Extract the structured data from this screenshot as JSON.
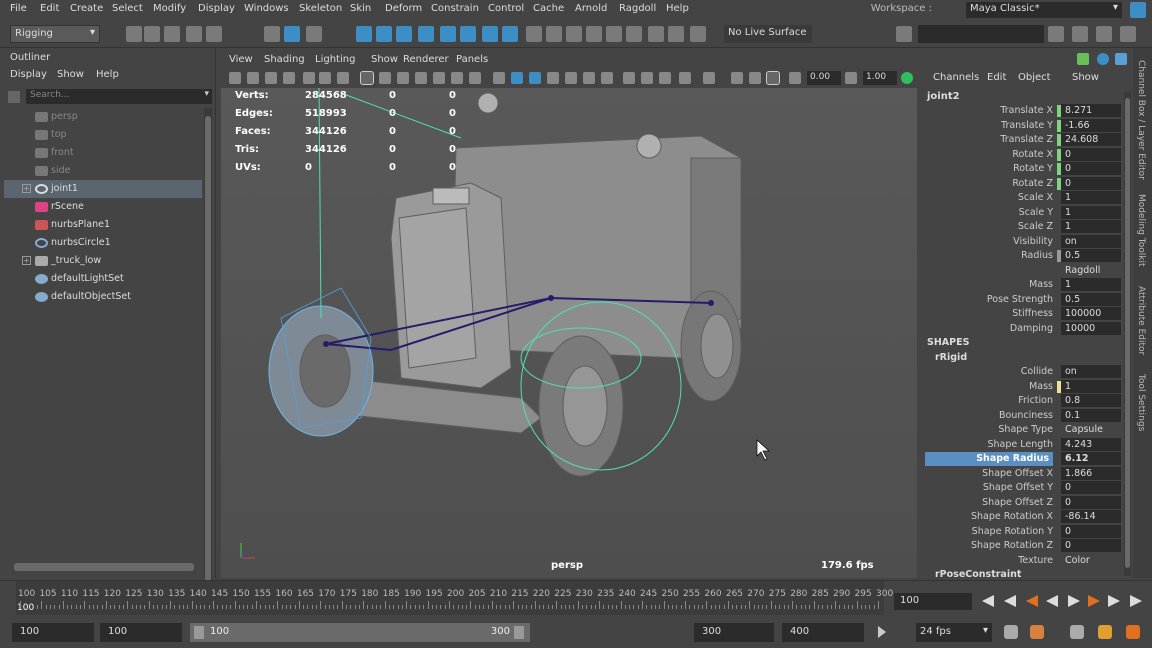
{
  "menubar": {
    "items": [
      "File",
      "Edit",
      "Create",
      "Select",
      "Modify",
      "Display",
      "Windows",
      "Skeleton",
      "Skin",
      "Deform",
      "Constrain",
      "Control",
      "Cache",
      "Arnold",
      "Ragdoll",
      "Help"
    ],
    "workspace_label": "Workspace :",
    "workspace_value": "Maya Classic*"
  },
  "toolbar": {
    "mode": "Rigging",
    "live_surface": "No Live Surface"
  },
  "outliner": {
    "title": "Outliner",
    "menu": [
      "Display",
      "Show",
      "Help"
    ],
    "search_placeholder": "Search...",
    "items": [
      {
        "label": "persp",
        "dim": true,
        "icon": "camera-icon"
      },
      {
        "label": "top",
        "dim": true,
        "icon": "camera-icon"
      },
      {
        "label": "front",
        "dim": true,
        "icon": "camera-icon"
      },
      {
        "label": "side",
        "dim": true,
        "icon": "camera-icon"
      },
      {
        "label": "joint1",
        "dim": false,
        "selected": true,
        "expandable": true,
        "icon": "joint-icon"
      },
      {
        "label": "rScene",
        "dim": false,
        "icon": "scene-icon"
      },
      {
        "label": "nurbsPlane1",
        "dim": false,
        "icon": "nurbs-plane-icon"
      },
      {
        "label": "nurbsCircle1",
        "dim": false,
        "icon": "nurbs-circle-icon"
      },
      {
        "label": "_truck_low",
        "dim": false,
        "expandable": true,
        "icon": "mesh-icon"
      },
      {
        "label": "defaultLightSet",
        "dim": false,
        "icon": "set-icon"
      },
      {
        "label": "defaultObjectSet",
        "dim": false,
        "icon": "set-icon"
      }
    ]
  },
  "viewport": {
    "menu": [
      "View",
      "Shading",
      "Lighting",
      "Show",
      "Renderer",
      "Panels"
    ],
    "field1": "0.00",
    "field2": "1.00",
    "hud": {
      "labels": [
        "Verts:",
        "Edges:",
        "Faces:",
        "Tris:",
        "UVs:"
      ],
      "col1": [
        "284568",
        "518993",
        "344126",
        "344126",
        "0"
      ],
      "col2": [
        "0",
        "0",
        "0",
        "0",
        "0"
      ],
      "col3": [
        "0",
        "0",
        "0",
        "0",
        "0"
      ]
    },
    "camera": "persp",
    "fps": "179.6 fps"
  },
  "channel_box": {
    "menu": [
      "Channels",
      "Edit",
      "Object",
      "Show"
    ],
    "node": "joint2",
    "rows": [
      {
        "label": "Translate X",
        "value": "8.271",
        "mark": "#7fd37f"
      },
      {
        "label": "Translate Y",
        "value": "-1.66",
        "mark": "#7fd37f"
      },
      {
        "label": "Translate Z",
        "value": "24.608",
        "mark": "#7fd37f"
      },
      {
        "label": "Rotate X",
        "value": "0",
        "mark": "#7fd37f"
      },
      {
        "label": "Rotate Y",
        "value": "0",
        "mark": "#7fd37f"
      },
      {
        "label": "Rotate Z",
        "value": "0",
        "mark": "#7fd37f"
      },
      {
        "label": "Scale X",
        "value": "1"
      },
      {
        "label": "Scale Y",
        "value": "1"
      },
      {
        "label": "Scale Z",
        "value": "1"
      },
      {
        "label": "Visibility",
        "value": "on"
      },
      {
        "label": "Radius",
        "value": "0.5",
        "mark": "#999999"
      },
      {
        "label": "",
        "value": "Ragdoll",
        "plain": true
      },
      {
        "label": "Mass",
        "value": "1"
      },
      {
        "label": "Pose Strength",
        "value": "0.5"
      },
      {
        "label": "Stiffness",
        "value": "100000"
      },
      {
        "label": "Damping",
        "value": "10000"
      },
      {
        "section": "SHAPES"
      },
      {
        "section": "rRigid",
        "indent": true
      },
      {
        "label": "Collide",
        "value": "on"
      },
      {
        "label": "Mass",
        "value": "1",
        "mark": "#f0e0a0"
      },
      {
        "label": "Friction",
        "value": "0.8"
      },
      {
        "label": "Bounciness",
        "value": "0.1"
      },
      {
        "label": "Shape Type",
        "value": "Capsule",
        "plain": true
      },
      {
        "label": "Shape Length",
        "value": "4.243"
      },
      {
        "label": "Shape Radius",
        "value": "6.12",
        "highlight": true
      },
      {
        "label": "Shape Offset X",
        "value": "1.866"
      },
      {
        "label": "Shape Offset Y",
        "value": "0"
      },
      {
        "label": "Shape Offset Z",
        "value": "0"
      },
      {
        "label": "Shape Rotation X",
        "value": "-86.14"
      },
      {
        "label": "Shape Rotation Y",
        "value": "0"
      },
      {
        "label": "Shape Rotation Z",
        "value": "0"
      },
      {
        "label": "Texture",
        "value": "Color",
        "plain": true
      },
      {
        "section": "rPoseConstraint",
        "indent": true
      }
    ]
  },
  "side_tabs": [
    "Channel Box / Layer Editor",
    "Modeling Toolkit",
    "Attribute Editor",
    "Tool Settings"
  ],
  "timeline": {
    "ticks": [
      "100",
      "105",
      "110",
      "115",
      "120",
      "125",
      "130",
      "135",
      "140",
      "145",
      "150",
      "155",
      "160",
      "165",
      "170",
      "175",
      "180",
      "185",
      "190",
      "195",
      "200",
      "205",
      "210",
      "215",
      "220",
      "225",
      "230",
      "235",
      "240",
      "245",
      "250",
      "255",
      "260",
      "265",
      "270",
      "275",
      "280",
      "285",
      "290",
      "295",
      "300"
    ],
    "current_marker": "100",
    "current_frame": "100"
  },
  "range": {
    "start": "100",
    "playback_start": "100",
    "slider_start": "100",
    "slider_end": "300",
    "playback_end": "300",
    "end": "400",
    "fps": "24 fps"
  }
}
